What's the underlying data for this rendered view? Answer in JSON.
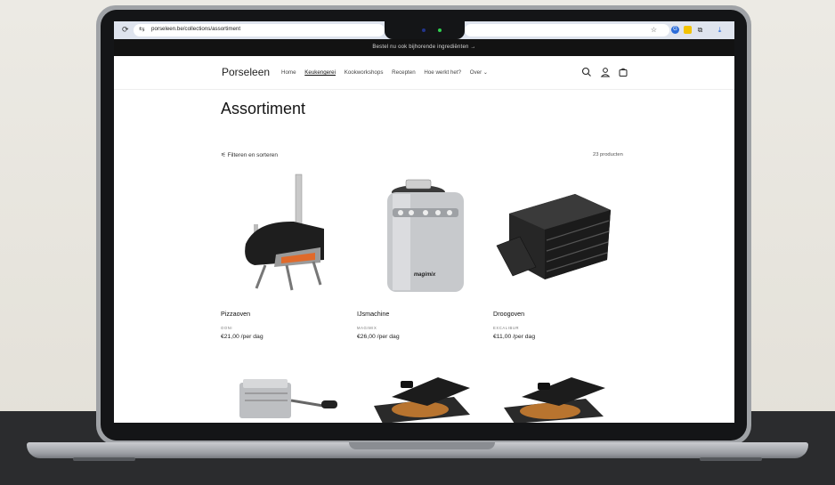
{
  "browser": {
    "url": "porseleen.be/collections/assortiment",
    "reload_icon": "reload-icon",
    "star_icon": "star-icon",
    "download_icon": "download-icon"
  },
  "announcement": {
    "text": "Bestel nu ook bijhorende ingrediënten  →"
  },
  "header": {
    "logo": "Porseleen",
    "nav": [
      {
        "label": "Home",
        "active": false
      },
      {
        "label": "Keukengerei",
        "active": true
      },
      {
        "label": "Kookworkshops",
        "active": false
      },
      {
        "label": "Recepten",
        "active": false
      },
      {
        "label": "Hoe werkt het?",
        "active": false
      },
      {
        "label": "Over  ⌄",
        "active": false
      }
    ],
    "icons": [
      "search-icon",
      "account-icon",
      "cart-icon"
    ]
  },
  "collection": {
    "title": "Assortiment",
    "filter_label": "Filteren en sorteren",
    "count_label": "23 producten"
  },
  "products": [
    {
      "name": "Pizzaoven",
      "brand": "OONI",
      "price": "€21,00 /per dag"
    },
    {
      "name": "IJsmachine",
      "brand": "MAGIMIX",
      "price": "€26,00 /per dag"
    },
    {
      "name": "Droogoven",
      "brand": "EXCALIBUR",
      "price": "€11,00 /per dag"
    }
  ],
  "product_image_labels": {
    "ijsmachine_brand": "magimix"
  },
  "colors": {
    "announcement_bg": "#121212",
    "page_bg": "#ffffff",
    "chrome_bg": "#dfe4ee"
  }
}
